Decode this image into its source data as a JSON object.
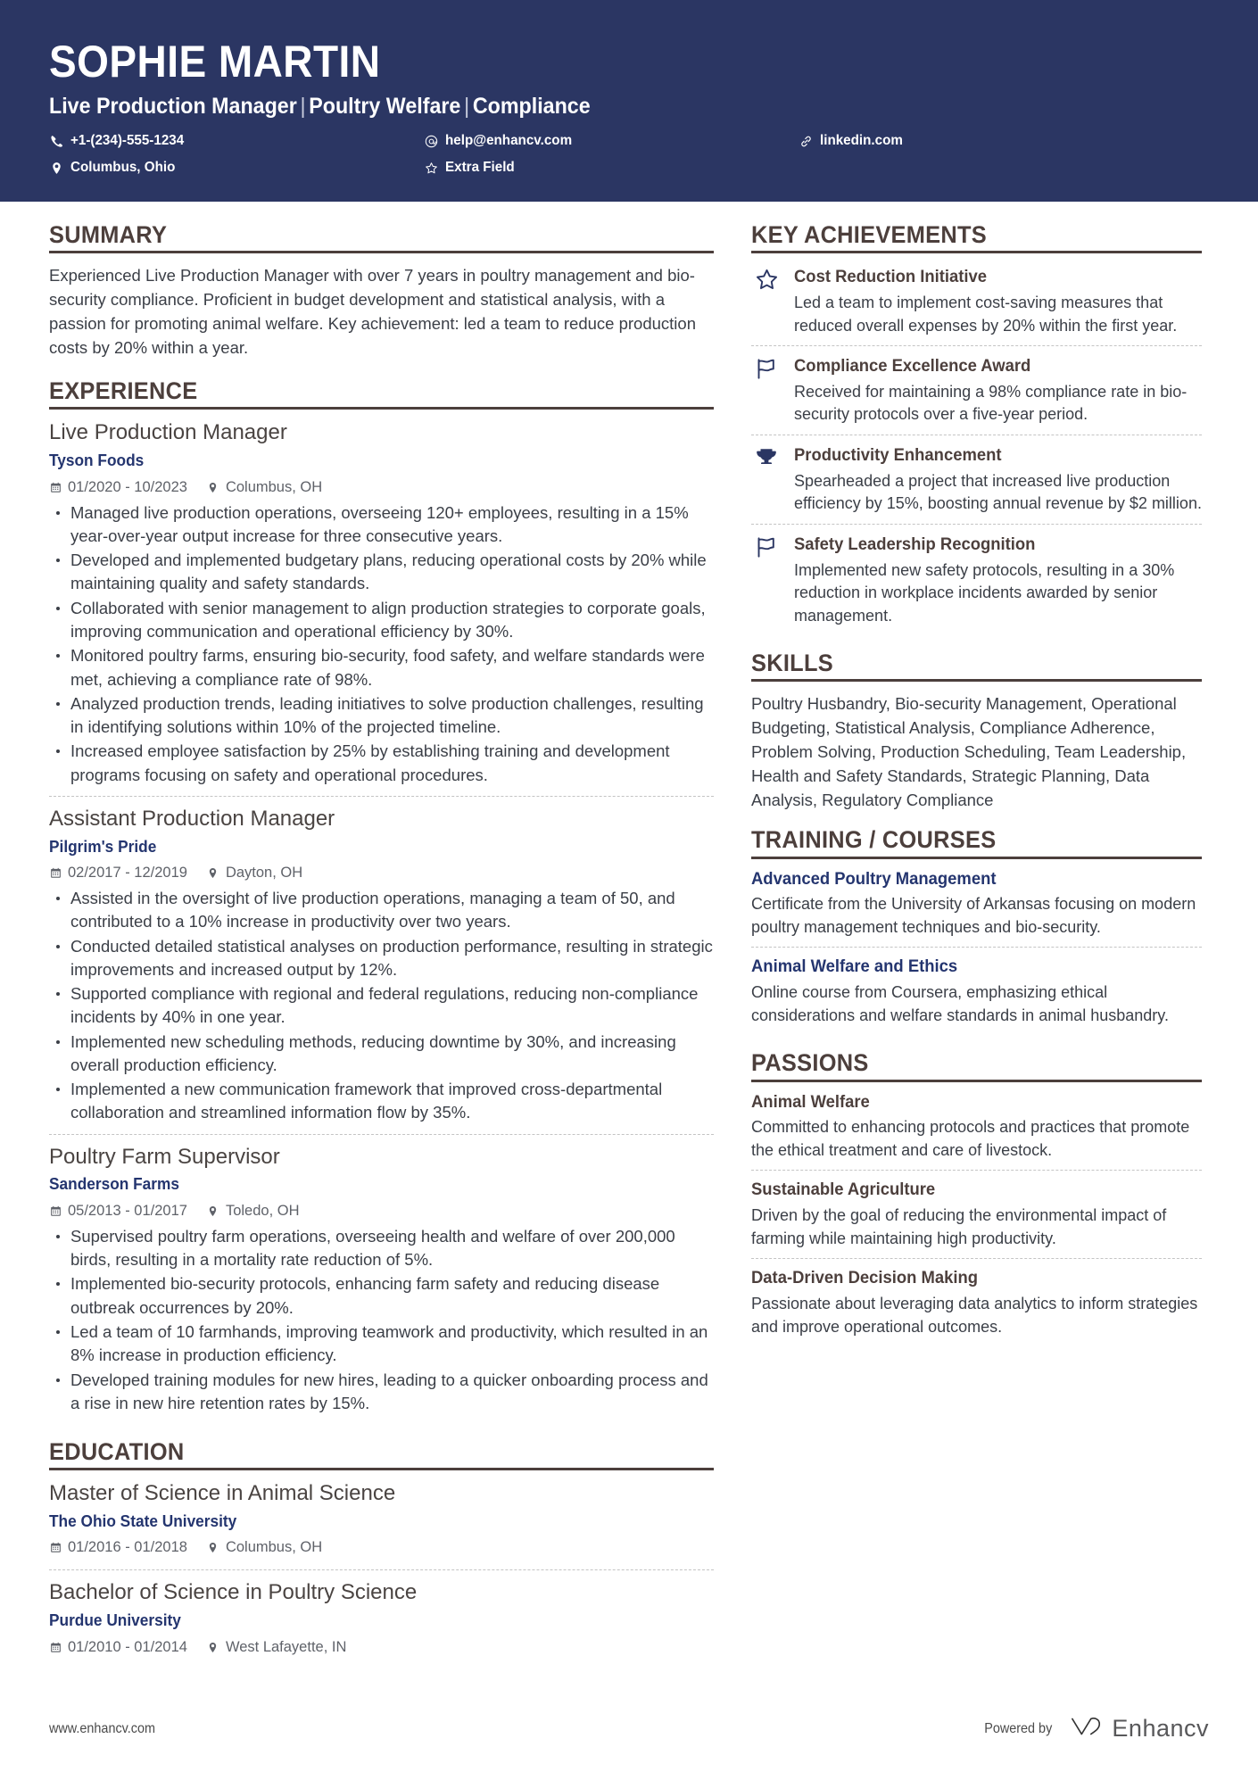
{
  "colors": {
    "header_bg": "#2b3663",
    "accent_brown": "#4c3f3c",
    "accent_navy": "#24356f",
    "body_text": "#3b3f47",
    "meta_text": "#5f6269"
  },
  "header": {
    "name": "SOPHIE MARTIN",
    "headline_parts": [
      "Live Production Manager",
      "Poultry Welfare",
      "Compliance"
    ],
    "separator": "|",
    "contacts": [
      {
        "icon": "phone-icon",
        "text": "+1-(234)-555-1234"
      },
      {
        "icon": "email-icon",
        "text": "help@enhancv.com"
      },
      {
        "icon": "link-icon",
        "text": "linkedin.com"
      },
      {
        "icon": "location-icon",
        "text": "Columbus, Ohio"
      },
      {
        "icon": "star-icon",
        "text": "Extra Field"
      }
    ]
  },
  "left": {
    "summary": {
      "title": "SUMMARY",
      "text": "Experienced Live Production Manager with over 7 years in poultry management and bio-security compliance. Proficient in budget development and statistical analysis, with a passion for promoting animal welfare. Key achievement: led a team to reduce production costs by 20% within a year."
    },
    "experience": {
      "title": "EXPERIENCE",
      "entries": [
        {
          "role": "Live Production Manager",
          "company": "Tyson Foods",
          "dates": "01/2020 - 10/2023",
          "location": "Columbus, OH",
          "bullets": [
            "Managed live production operations, overseeing 120+ employees, resulting in a 15% year-over-year output increase for three consecutive years.",
            "Developed and implemented budgetary plans, reducing operational costs by 20% while maintaining quality and safety standards.",
            "Collaborated with senior management to align production strategies to corporate goals, improving communication and operational efficiency by 30%.",
            "Monitored poultry farms, ensuring bio-security, food safety, and welfare standards were met, achieving a compliance rate of 98%.",
            "Analyzed production trends, leading initiatives to solve production challenges, resulting in identifying solutions within 10% of the projected timeline.",
            "Increased employee satisfaction by 25% by establishing training and development programs focusing on safety and operational procedures."
          ]
        },
        {
          "role": "Assistant Production Manager",
          "company": "Pilgrim's Pride",
          "dates": "02/2017 - 12/2019",
          "location": "Dayton, OH",
          "bullets": [
            "Assisted in the oversight of live production operations, managing a team of 50, and contributed to a 10% increase in productivity over two years.",
            "Conducted detailed statistical analyses on production performance, resulting in strategic improvements and increased output by 12%.",
            "Supported compliance with regional and federal regulations, reducing non-compliance incidents by 40% in one year.",
            "Implemented new scheduling methods, reducing downtime by 30%, and increasing overall production efficiency.",
            "Implemented a new communication framework that improved cross-departmental collaboration and streamlined information flow by 35%."
          ]
        },
        {
          "role": "Poultry Farm Supervisor",
          "company": "Sanderson Farms",
          "dates": "05/2013 - 01/2017",
          "location": "Toledo, OH",
          "bullets": [
            "Supervised poultry farm operations, overseeing health and welfare of over 200,000 birds, resulting in a mortality rate reduction of 5%.",
            "Implemented bio-security protocols, enhancing farm safety and reducing disease outbreak occurrences by 20%.",
            "Led a team of 10 farmhands, improving teamwork and productivity, which resulted in an 8% increase in production efficiency.",
            "Developed training modules for new hires, leading to a quicker onboarding process and a rise in new hire retention rates by 15%."
          ]
        }
      ]
    },
    "education": {
      "title": "EDUCATION",
      "entries": [
        {
          "degree": "Master of Science in Animal Science",
          "school": "The Ohio State University",
          "dates": "01/2016 - 01/2018",
          "location": "Columbus, OH"
        },
        {
          "degree": "Bachelor of Science in Poultry Science",
          "school": "Purdue University",
          "dates": "01/2010 - 01/2014",
          "location": "West Lafayette, IN"
        }
      ]
    }
  },
  "right": {
    "achievements": {
      "title": "KEY ACHIEVEMENTS",
      "items": [
        {
          "icon": "star-outline-icon",
          "title": "Cost Reduction Initiative",
          "description": "Led a team to implement cost-saving measures that reduced overall expenses by 20% within the first year."
        },
        {
          "icon": "flag-icon",
          "title": "Compliance Excellence Award",
          "description": "Received for maintaining a 98% compliance rate in bio-security protocols over a five-year period."
        },
        {
          "icon": "trophy-icon",
          "title": "Productivity Enhancement",
          "description": "Spearheaded a project that increased live production efficiency by 15%, boosting annual revenue by $2 million."
        },
        {
          "icon": "flag-icon",
          "title": "Safety Leadership Recognition",
          "description": "Implemented new safety protocols, resulting in a 30% reduction in workplace incidents awarded by senior management."
        }
      ]
    },
    "skills": {
      "title": "SKILLS",
      "text": "Poultry Husbandry, Bio-security Management, Operational Budgeting, Statistical Analysis, Compliance Adherence, Problem Solving, Production Scheduling, Team Leadership, Health and Safety Standards, Strategic Planning, Data Analysis, Regulatory Compliance"
    },
    "training": {
      "title": "TRAINING / COURSES",
      "items": [
        {
          "title": "Advanced Poultry Management",
          "description": "Certificate from the University of Arkansas focusing on modern poultry management techniques and bio-security."
        },
        {
          "title": "Animal Welfare and Ethics",
          "description": "Online course from Coursera, emphasizing ethical considerations and welfare standards in animal husbandry."
        }
      ]
    },
    "passions": {
      "title": "PASSIONS",
      "items": [
        {
          "title": "Animal Welfare",
          "description": "Committed to enhancing protocols and practices that promote the ethical treatment and care of livestock."
        },
        {
          "title": "Sustainable Agriculture",
          "description": "Driven by the goal of reducing the environmental impact of farming while maintaining high productivity."
        },
        {
          "title": "Data-Driven Decision Making",
          "description": "Passionate about leveraging data analytics to inform strategies and improve operational outcomes."
        }
      ]
    }
  },
  "footer": {
    "url": "www.enhancv.com",
    "powered_by": "Powered by",
    "brand": "Enhancv"
  }
}
